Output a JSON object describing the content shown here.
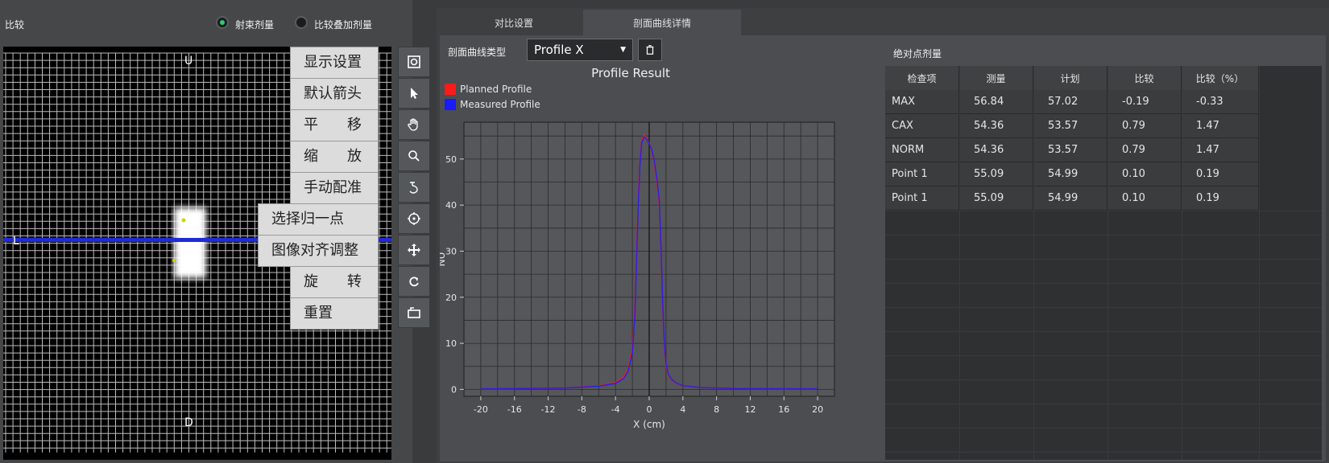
{
  "left_panel": {
    "title": "比较",
    "radio_options": [
      {
        "label": "射束剂量",
        "selected": true
      },
      {
        "label": "比较叠加剂量",
        "selected": false
      }
    ],
    "viewer": {
      "label_top": "U",
      "label_left": "L",
      "label_bottom": "D"
    },
    "context_menu": [
      "显示设置",
      "默认箭头",
      "平　　移",
      "缩　　放",
      "手动配准",
      "选择归一点",
      "图像对齐调整",
      "旋　　转",
      "重置"
    ],
    "toolbar_icons": [
      "display-settings-icon",
      "pointer-icon",
      "hand-pan-icon",
      "zoom-icon",
      "manual-register-icon",
      "target-icon",
      "move-icon",
      "rotate-icon",
      "reset-icon"
    ]
  },
  "right_panel": {
    "tabs": [
      {
        "label": "对比设置",
        "active": false
      },
      {
        "label": "剖面曲线详情",
        "active": true
      }
    ],
    "profile_type_label": "剖面曲线类型",
    "profile_type_value": "Profile X",
    "abs_point_dose_label": "绝对点剂量",
    "table": {
      "columns": [
        "检查项",
        "测量",
        "计划",
        "比较",
        "比较（%）"
      ],
      "rows": [
        [
          "MAX",
          "56.84",
          "57.02",
          "-0.19",
          "-0.33"
        ],
        [
          "CAX",
          "54.36",
          "53.57",
          "0.79",
          "1.47"
        ],
        [
          "NORM",
          "54.36",
          "53.57",
          "0.79",
          "1.47"
        ],
        [
          "Point 1",
          "55.09",
          "54.99",
          "0.10",
          "0.19"
        ],
        [
          "Point 1",
          "55.09",
          "54.99",
          "0.10",
          "0.19"
        ]
      ]
    }
  },
  "chart_data": {
    "type": "line",
    "title": "Profile Result",
    "xlabel": "X (cm)",
    "ylabel": "NU",
    "xlim": [
      -22,
      22
    ],
    "ylim": [
      -1.5,
      58
    ],
    "xticks": [
      -20,
      -16,
      -12,
      -8,
      -4,
      0,
      4,
      8,
      12,
      16,
      20
    ],
    "yticks": [
      0,
      10,
      20,
      30,
      40,
      50
    ],
    "grid": true,
    "legend_position": "top-left",
    "series": [
      {
        "name": "Planned Profile",
        "color": "#ff1a1a",
        "x": [
          -20,
          -10,
          -6,
          -4,
          -3,
          -2.5,
          -2,
          -1.7,
          -1.5,
          -1.3,
          -1.1,
          -0.9,
          -0.6,
          -0.3,
          0,
          0.3,
          0.6,
          0.9,
          1.2,
          1.4,
          1.6,
          1.8,
          2.0,
          2.3,
          2.7,
          3.2,
          4,
          6,
          10,
          20
        ],
        "y": [
          0.1,
          0.3,
          0.8,
          1.5,
          2.8,
          4.5,
          9,
          18,
          30,
          42,
          50,
          54,
          55.2,
          54.6,
          53.5,
          52,
          49,
          45,
          40,
          30,
          18,
          9,
          5,
          3,
          2,
          1.3,
          0.8,
          0.4,
          0.2,
          0.1
        ]
      },
      {
        "name": "Measured Profile",
        "color": "#1a1aff",
        "x": [
          -20,
          -10,
          -6,
          -4,
          -3,
          -2.5,
          -2,
          -1.7,
          -1.5,
          -1.3,
          -1.1,
          -0.9,
          -0.6,
          -0.3,
          0,
          0.3,
          0.6,
          0.9,
          1.2,
          1.4,
          1.6,
          1.8,
          2.0,
          2.3,
          2.7,
          3.2,
          4,
          6,
          10,
          20
        ],
        "y": [
          0.1,
          0.3,
          0.7,
          1.3,
          2.4,
          4,
          8,
          16,
          28,
          40,
          49,
          53.5,
          54.8,
          54.3,
          53.3,
          52.1,
          49.6,
          45.8,
          41,
          31,
          19,
          10,
          5.5,
          3.2,
          2.1,
          1.4,
          0.8,
          0.4,
          0.2,
          0.1
        ]
      }
    ]
  },
  "colors": {
    "accent_green": "#2ecc71",
    "beam_line": "#1f2bd6"
  }
}
